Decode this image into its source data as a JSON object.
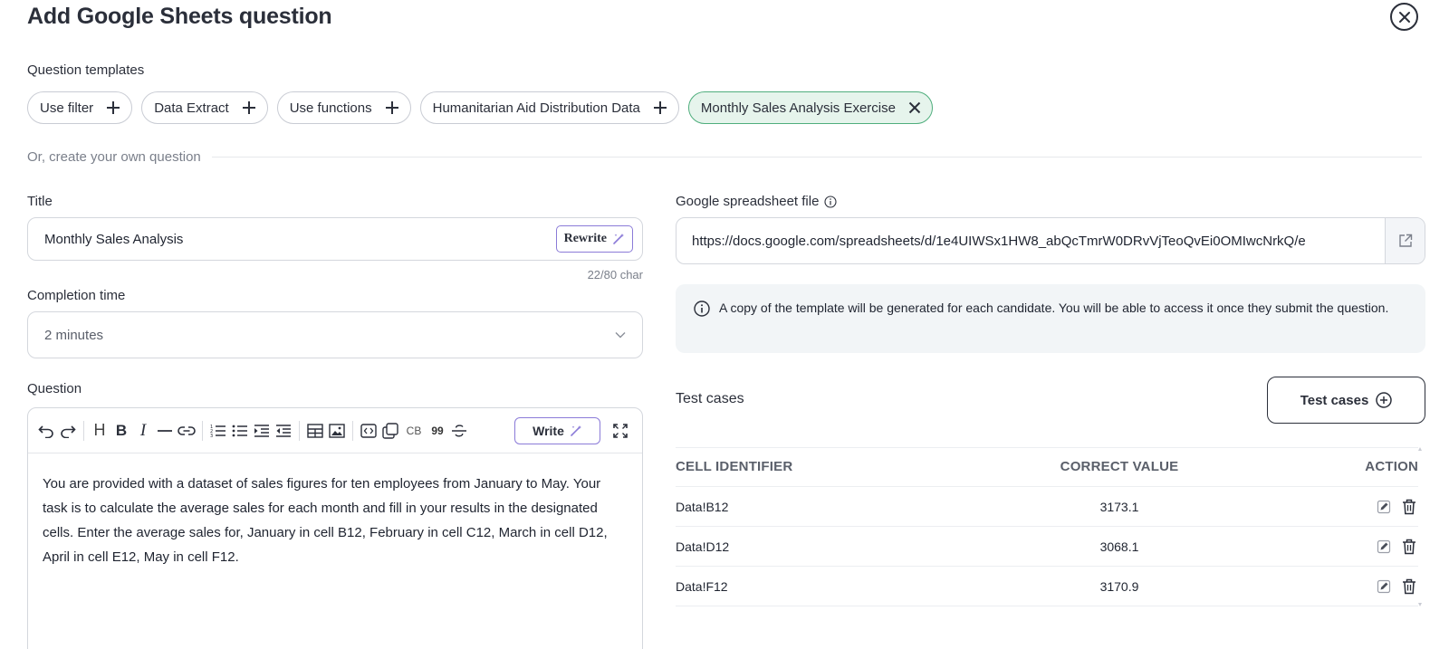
{
  "modal": {
    "title": "Add Google Sheets question"
  },
  "templates": {
    "label": "Question templates",
    "items": [
      {
        "label": "Use filter",
        "active": false
      },
      {
        "label": "Data Extract",
        "active": false
      },
      {
        "label": "Use functions",
        "active": false
      },
      {
        "label": "Humanitarian Aid Distribution Data",
        "active": false
      },
      {
        "label": "Monthly Sales Analysis Exercise",
        "active": true
      }
    ]
  },
  "divider_text": "Or, create your own question",
  "title_field": {
    "label": "Title",
    "value": "Monthly Sales Analysis",
    "rewrite_label": "Rewrite",
    "char_count": "22/80 char"
  },
  "completion_time": {
    "label": "Completion time",
    "value": "2 minutes"
  },
  "question": {
    "label": "Question",
    "write_label": "Write",
    "toolbar_cb": "CB",
    "toolbar_quote": "99",
    "toolbar_heading": "H",
    "toolbar_bold": "B",
    "toolbar_italic": "I",
    "body": "You are provided with a dataset of sales figures for ten employees from January to May. Your task is to calculate the average sales for each month and fill in your results in the designated cells. Enter the average sales for, January in cell B12, February in cell C12, March in cell D12, April in cell E12, May in cell F12."
  },
  "spreadsheet": {
    "label": "Google spreadsheet file",
    "url": "https://docs.google.com/spreadsheets/d/1e4UIWSx1HW8_abQcTmrW0DRvVjTeoQvEi0OMIwcNrkQ/e",
    "info": "A copy of the template will be generated for each candidate. You will be able to access it once they submit the question."
  },
  "test_cases": {
    "label": "Test cases",
    "button_label": "Test cases",
    "headers": {
      "cell": "CELL IDENTIFIER",
      "value": "CORRECT VALUE",
      "action": "ACTION"
    },
    "rows": [
      {
        "cell": "Data!B12",
        "value": "3173.1"
      },
      {
        "cell": "Data!D12",
        "value": "3068.1"
      },
      {
        "cell": "Data!F12",
        "value": "3170.9"
      }
    ]
  },
  "colors": {
    "active_chip_bg": "#e6f4ec",
    "active_chip_border": "#4fae7d",
    "ai_border": "#8b7bd8",
    "info_bg": "#f2f5f7"
  }
}
